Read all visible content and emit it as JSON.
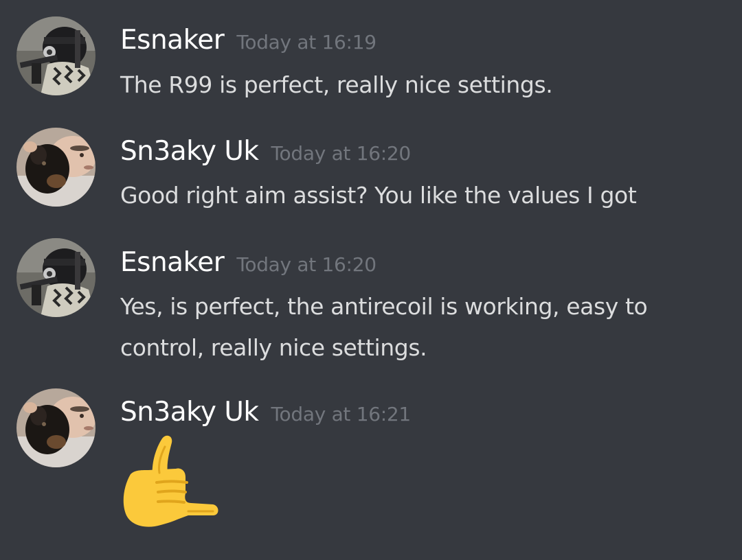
{
  "messages": [
    {
      "author": "Esnaker",
      "timestamp": "Today at 16:19",
      "text": "The R99 is perfect, really nice settings.",
      "avatar": "soldier-avatar"
    },
    {
      "author": "Sn3aky Uk",
      "timestamp": "Today at 16:20",
      "text": "Good right aim assist? You like the values I got",
      "avatar": "face-with-dog-avatar"
    },
    {
      "author": "Esnaker",
      "timestamp": "Today at 16:20",
      "text": "Yes, is perfect, the antirecoil is working, easy to control, really nice settings.",
      "avatar": "soldier-avatar"
    },
    {
      "author": "Sn3aky Uk",
      "timestamp": "Today at 16:21",
      "text": "",
      "avatar": "face-with-dog-avatar",
      "emoji": "call-me-hand-emoji"
    }
  ],
  "colors": {
    "background": "#36393f",
    "username": "#ffffff",
    "timestamp": "#72767d",
    "message_text": "#dcddde",
    "emoji_yellow": "#fbc93b"
  }
}
